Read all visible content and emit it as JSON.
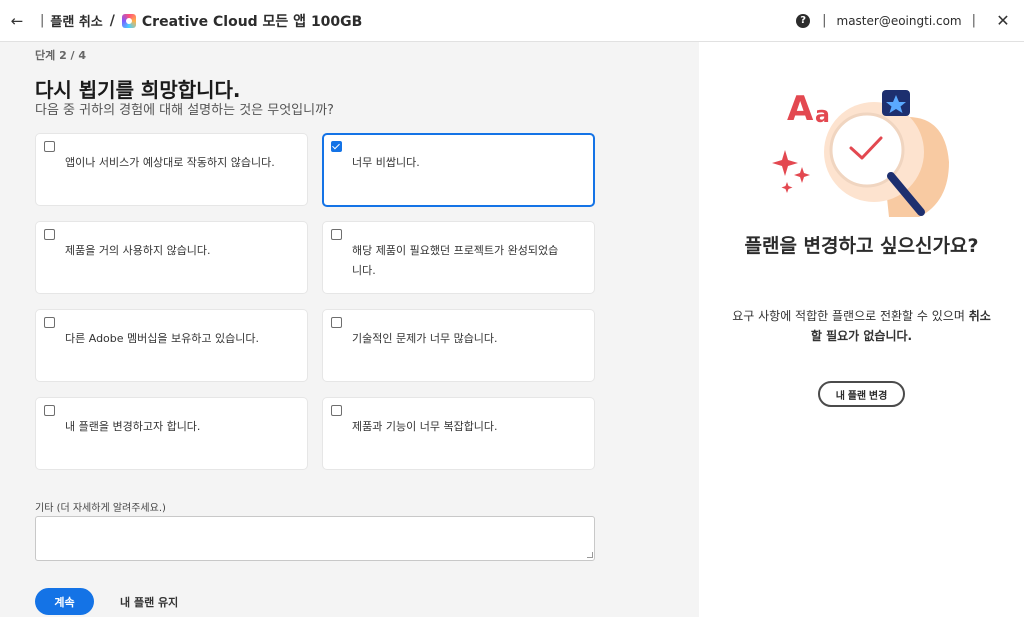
{
  "header": {
    "back_icon": "arrow-left-icon",
    "breadcrumb": "플랜 취소",
    "slash": "/",
    "product": "Creative Cloud 모든 앱 100GB",
    "help_icon": "question-circle-icon",
    "email": "master@eoingti.com",
    "close_icon": "close-icon"
  },
  "main": {
    "step": "단계 2 / 4",
    "title": "다시 뵙기를 희망합니다.",
    "subtitle": "다음 중 귀하의 경험에 대해 설명하는 것은 무엇입니까?",
    "options": [
      {
        "label": "앱이나 서비스가 예상대로 작동하지 않습니다.",
        "checked": false
      },
      {
        "label": "너무 비쌉니다.",
        "checked": true
      },
      {
        "label": "제품을 거의 사용하지 않습니다.",
        "checked": false
      },
      {
        "label": "해당 제품이 필요했던 프로젝트가 완성되었습니다.",
        "checked": false
      },
      {
        "label": "다른 Adobe 멤버십을 보유하고 있습니다.",
        "checked": false
      },
      {
        "label": "기술적인 문제가 너무 많습니다.",
        "checked": false
      },
      {
        "label": "내 플랜을 변경하고자 합니다.",
        "checked": false
      },
      {
        "label": "제품과 기능이 너무 복잡합니다.",
        "checked": false
      }
    ],
    "other_label": "기타 (더 자세하게 알려주세요.)",
    "other_value": "",
    "continue_label": "계속",
    "keep_label": "내 플랜 유지"
  },
  "side": {
    "title": "플랜을 변경하고 싶으신가요?",
    "desc_part1": "요구 사항에 적합한 플랜으로 전환할 수 있으며 ",
    "desc_bold": "취소할 필요가 없습니다.",
    "change_label": "내 플랜 변경"
  },
  "colors": {
    "accent": "#1473e6",
    "panel_bg": "#f4f4f4",
    "illus_red": "#e34850",
    "illus_navy": "#1d2f6f"
  }
}
